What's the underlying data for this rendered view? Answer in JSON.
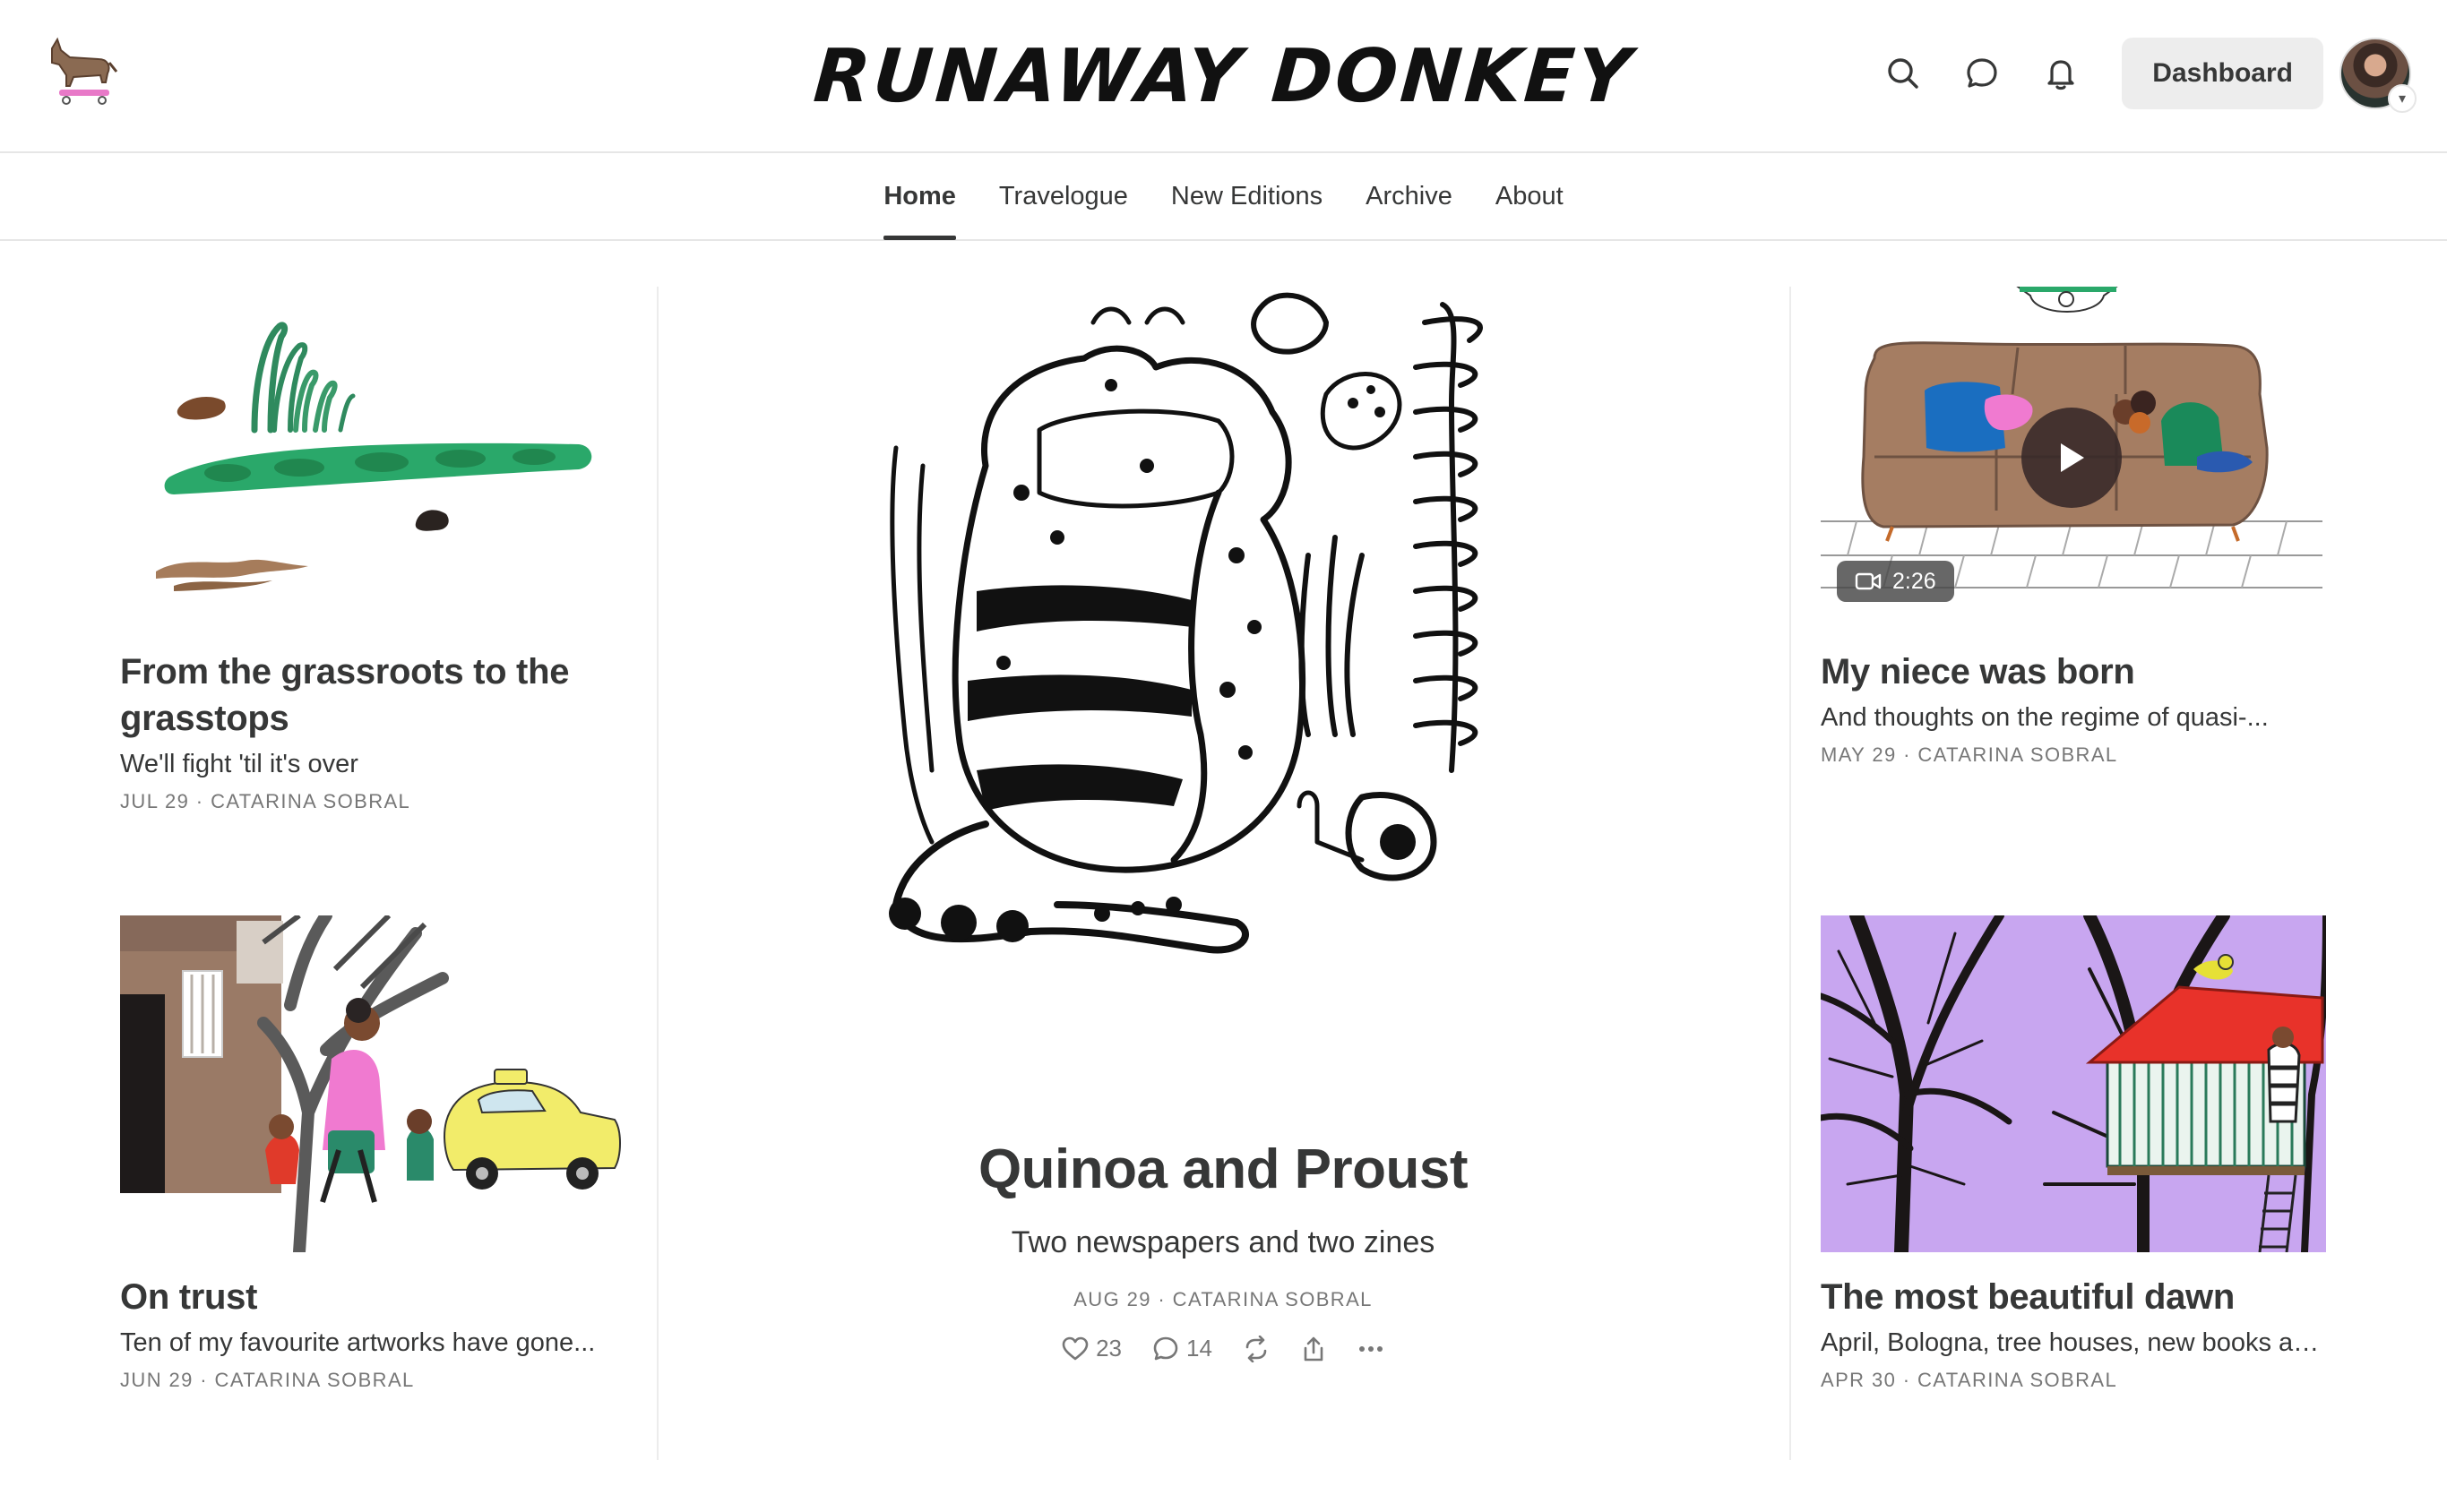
{
  "header": {
    "brand": "RUNAWAY DONKEY",
    "logo_icon": "donkey-on-skateboard-icon",
    "icons": [
      "search-icon",
      "chat-icon",
      "bell-icon"
    ],
    "dashboard_label": "Dashboard"
  },
  "nav": {
    "items": [
      {
        "label": "Home",
        "active": true
      },
      {
        "label": "Travelogue"
      },
      {
        "label": "New Editions"
      },
      {
        "label": "Archive"
      },
      {
        "label": "About"
      }
    ]
  },
  "posts": {
    "left_top": {
      "title": "From the grassroots to the grasstops",
      "subtitle": "We'll fight 'til it's over",
      "date": "JUL 29",
      "author": "CATARINA SOBRAL"
    },
    "left_bottom": {
      "title": "On trust",
      "subtitle": "Ten of my favourite artworks have gone...",
      "date": "JUN 29",
      "author": "CATARINA SOBRAL"
    },
    "feature": {
      "title": "Quinoa and Proust",
      "subtitle": "Two newspapers and two zines",
      "date": "AUG 29",
      "author": "CATARINA SOBRAL",
      "likes": "23",
      "comments": "14"
    },
    "right_top": {
      "title": "My niece was born",
      "subtitle": "And thoughts on the regime of quasi-...",
      "date": "MAY 29",
      "author": "CATARINA SOBRAL",
      "video_duration": "2:26"
    },
    "right_bottom": {
      "title": "The most beautiful dawn",
      "subtitle": "April, Bologna, tree houses, new books an...",
      "date": "APR 30",
      "author": "CATARINA SOBRAL"
    }
  },
  "meta_separator": " · ",
  "colors": {
    "text": "#363737",
    "muted": "#777777",
    "divider": "#e6e6e6",
    "button_bg": "#ededed",
    "lavender": "#c8a6f0",
    "green": "#2aa86a",
    "red_roof": "#e8322a"
  }
}
